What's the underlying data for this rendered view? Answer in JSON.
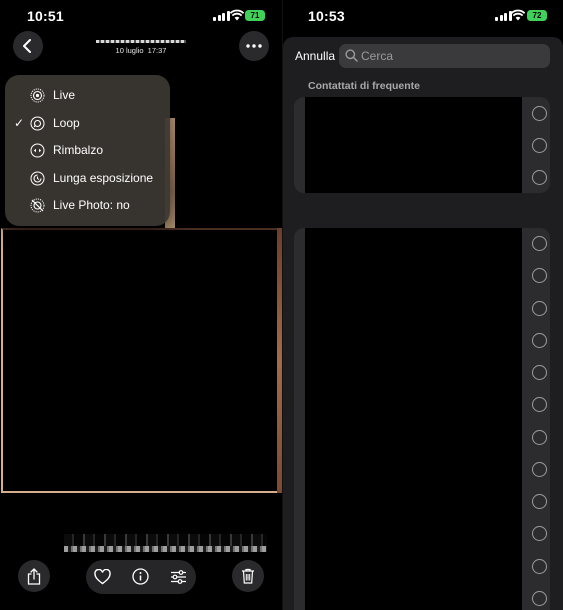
{
  "left_status": {
    "time": "10:51",
    "battery": "71"
  },
  "right_status": {
    "time": "10:53",
    "battery": "72"
  },
  "photo": {
    "date": "10 luglio",
    "time": "17:37"
  },
  "live_menu": {
    "items": [
      {
        "label": "Live",
        "icon": "live-icon",
        "checked": false
      },
      {
        "label": "Loop",
        "icon": "loop-icon",
        "checked": true
      },
      {
        "label": "Rimbalzo",
        "icon": "bounce-icon",
        "checked": false
      },
      {
        "label": "Lunga esposizione",
        "icon": "long-exposure-icon",
        "checked": false
      },
      {
        "label": "Live Photo: no",
        "icon": "live-off-icon",
        "checked": false
      }
    ],
    "check_glyph": "✓"
  },
  "toolbar": {
    "share": "share-icon",
    "favorite": "heart-icon",
    "info": "info-icon",
    "edit": "sliders-icon",
    "delete": "trash-icon"
  },
  "share_sheet": {
    "cancel_label": "Annulla",
    "search_placeholder": "Cerca",
    "section_title": "Contattati di frequente"
  },
  "colors": {
    "battery": "#3fd15a",
    "menu_bg": "#3a3632",
    "sheet_bg": "#1e1e20",
    "row_bg": "#2c2c2e"
  }
}
